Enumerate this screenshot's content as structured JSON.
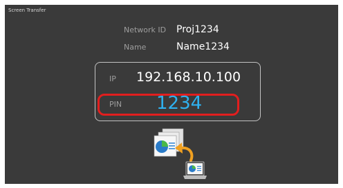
{
  "app": {
    "title": "Screen Transfer"
  },
  "network": {
    "id_label": "Network ID",
    "id_value": "Proj1234",
    "name_label": "Name",
    "name_value": "Name1234"
  },
  "connection": {
    "ip_label": "IP",
    "ip_value": "192.168.10.100",
    "pin_label": "PIN",
    "pin_value": "1234"
  },
  "graphic": {
    "icon": "screen-transfer-icon",
    "accent_color": "#f0a020",
    "highlight_color": "#e21e1e",
    "pin_color": "#2fb1f0"
  }
}
